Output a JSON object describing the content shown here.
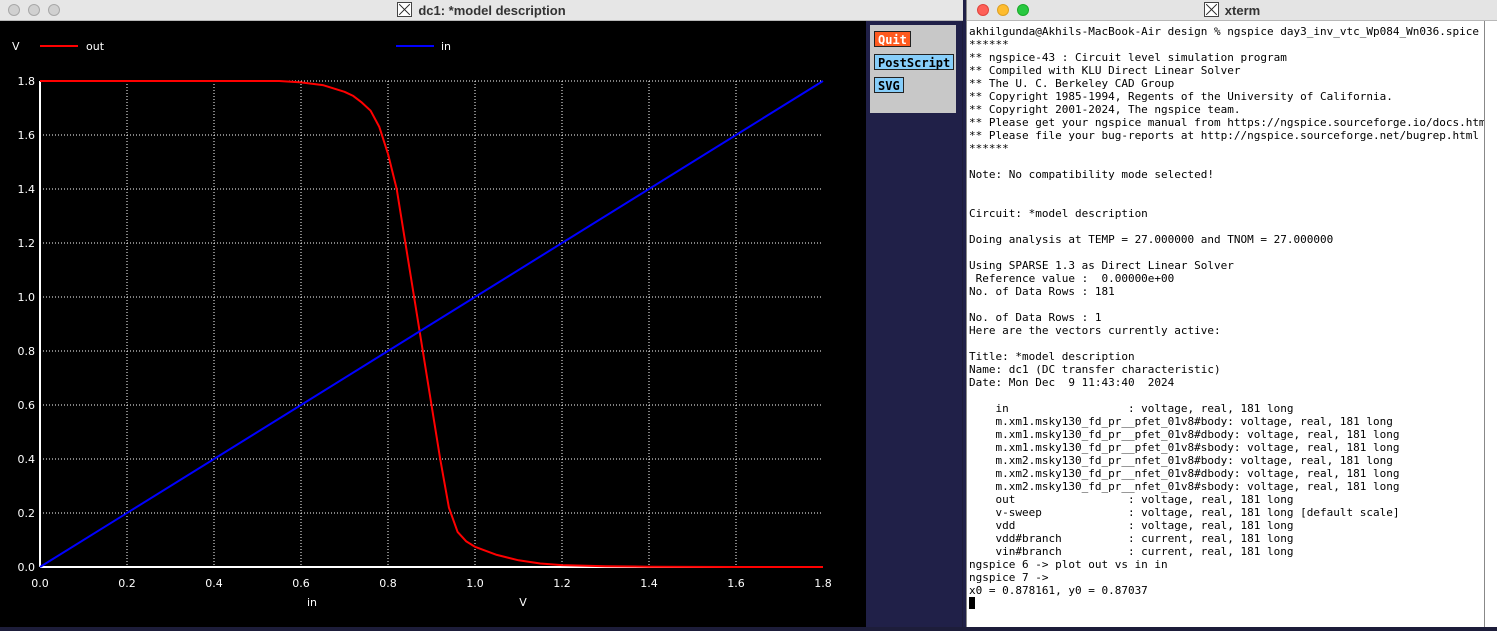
{
  "plot_window": {
    "title": "dc1: *model description",
    "buttons": {
      "quit": "Quit",
      "postscript": "PostScript",
      "svg": "SVG"
    }
  },
  "chart_data": {
    "type": "line",
    "ylabel": "V",
    "xlabel_left": "in",
    "xlabel_right": "V",
    "xlim": [
      0,
      1.8
    ],
    "ylim": [
      0,
      1.8
    ],
    "xticks": [
      "0.0",
      "0.2",
      "0.4",
      "0.6",
      "0.8",
      "1.0",
      "1.2",
      "1.4",
      "1.6",
      "1.8"
    ],
    "yticks": [
      "0.0",
      "0.2",
      "0.4",
      "0.6",
      "0.8",
      "1.0",
      "1.2",
      "1.4",
      "1.6",
      "1.8"
    ],
    "grid": true,
    "colors": {
      "background": "#000000",
      "axes": "#ffffff",
      "grid": "#ffffff",
      "out": "#ff0000",
      "in": "#0000ff"
    },
    "series": [
      {
        "name": "out",
        "x": [
          0,
          0.2,
          0.4,
          0.55,
          0.6,
          0.65,
          0.7,
          0.72,
          0.74,
          0.76,
          0.78,
          0.8,
          0.82,
          0.84,
          0.86,
          0.88,
          0.9,
          0.92,
          0.94,
          0.96,
          0.98,
          1.0,
          1.05,
          1.1,
          1.15,
          1.2,
          1.3,
          1.4,
          1.6,
          1.8
        ],
        "y": [
          1.8,
          1.8,
          1.8,
          1.8,
          1.795,
          1.785,
          1.76,
          1.745,
          1.72,
          1.69,
          1.63,
          1.53,
          1.4,
          1.2,
          1.0,
          0.8,
          0.6,
          0.4,
          0.22,
          0.13,
          0.095,
          0.075,
          0.045,
          0.025,
          0.013,
          0.007,
          0.003,
          0.001,
          0.0,
          0.0
        ]
      },
      {
        "name": "in",
        "x": [
          0,
          1.8
        ],
        "y": [
          0,
          1.8
        ]
      }
    ]
  },
  "terminal": {
    "title": "xterm",
    "lines": [
      "akhilgunda@Akhils-MacBook-Air design % ngspice day3_inv_vtc_Wp084_Wn036.spice",
      "******",
      "** ngspice-43 : Circuit level simulation program",
      "** Compiled with KLU Direct Linear Solver",
      "** The U. C. Berkeley CAD Group",
      "** Copyright 1985-1994, Regents of the University of California.",
      "** Copyright 2001-2024, The ngspice team.",
      "** Please get your ngspice manual from https://ngspice.sourceforge.io/docs.html",
      "** Please file your bug-reports at http://ngspice.sourceforge.net/bugrep.html",
      "******",
      "",
      "Note: No compatibility mode selected!",
      "",
      "",
      "Circuit: *model description",
      "",
      "Doing analysis at TEMP = 27.000000 and TNOM = 27.000000",
      "",
      "Using SPARSE 1.3 as Direct Linear Solver",
      " Reference value :  0.00000e+00",
      "No. of Data Rows : 181",
      "",
      "No. of Data Rows : 1",
      "Here are the vectors currently active:",
      "",
      "Title: *model description",
      "Name: dc1 (DC transfer characteristic)",
      "Date: Mon Dec  9 11:43:40  2024",
      "",
      "    in                  : voltage, real, 181 long",
      "    m.xm1.msky130_fd_pr__pfet_01v8#body: voltage, real, 181 long",
      "    m.xm1.msky130_fd_pr__pfet_01v8#dbody: voltage, real, 181 long",
      "    m.xm1.msky130_fd_pr__pfet_01v8#sbody: voltage, real, 181 long",
      "    m.xm2.msky130_fd_pr__nfet_01v8#body: voltage, real, 181 long",
      "    m.xm2.msky130_fd_pr__nfet_01v8#dbody: voltage, real, 181 long",
      "    m.xm2.msky130_fd_pr__nfet_01v8#sbody: voltage, real, 181 long",
      "    out                 : voltage, real, 181 long",
      "    v-sweep             : voltage, real, 181 long [default scale]",
      "    vdd                 : voltage, real, 181 long",
      "    vdd#branch          : current, real, 181 long",
      "    vin#branch          : current, real, 181 long",
      "ngspice 6 -> plot out vs in in",
      "ngspice 7 ->",
      "x0 = 0.878161, y0 = 0.87037"
    ]
  }
}
